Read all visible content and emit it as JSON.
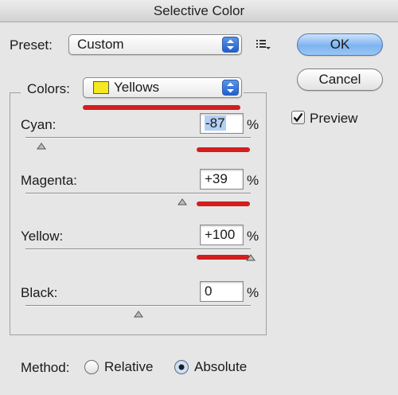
{
  "window": {
    "title": "Selective Color"
  },
  "preset": {
    "label": "Preset:",
    "value": "Custom",
    "swatch_color": "#f5e820"
  },
  "buttons": {
    "ok": "OK",
    "cancel": "Cancel"
  },
  "preview": {
    "label": "Preview",
    "checked": true
  },
  "colors": {
    "label": "Colors:",
    "value": "Yellows"
  },
  "sliders": [
    {
      "label": "Cyan:",
      "value": "-87",
      "unit": "%",
      "level": -87
    },
    {
      "label": "Magenta:",
      "value": "+39",
      "unit": "%",
      "level": 39
    },
    {
      "label": "Yellow:",
      "value": "+100",
      "unit": "%",
      "level": 100
    },
    {
      "label": "Black:",
      "value": "0",
      "unit": "%",
      "level": 0
    }
  ],
  "method": {
    "label": "Method:",
    "options": [
      {
        "label": "Relative",
        "selected": false
      },
      {
        "label": "Absolute",
        "selected": true
      }
    ]
  },
  "annotation_color": "#d41d1d",
  "accent_color": "#2f6fdc",
  "icons": {
    "stepper": "up-down-arrows-icon",
    "preset_menu": "list-menu-icon",
    "slider_thumb": "triangle-thumb-icon"
  }
}
